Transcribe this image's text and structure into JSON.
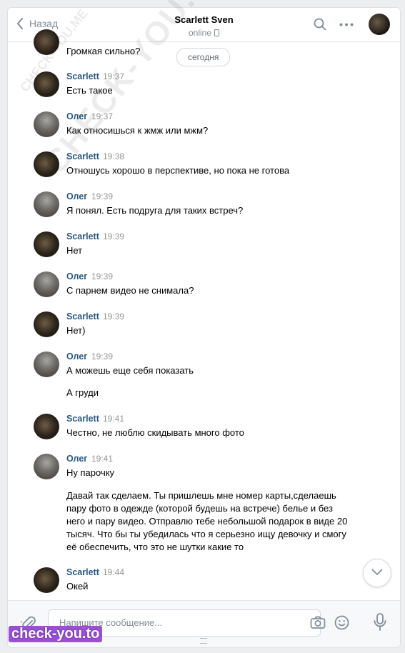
{
  "header": {
    "back_label": "Назад",
    "title": "Scarlett Sven",
    "status": "online"
  },
  "date_divider": "сегодня",
  "partial_message": "Громкая сильно?",
  "messages": [
    {
      "author": "Scarlett",
      "time": "19:37",
      "avatar": "scarlett",
      "lines": [
        "Есть такое"
      ]
    },
    {
      "author": "Олег",
      "time": "19:37",
      "avatar": "oleg",
      "lines": [
        "Как относишься к жмж или мжм?"
      ]
    },
    {
      "author": "Scarlett",
      "time": "19:38",
      "avatar": "scarlett",
      "lines": [
        "Отношусь хорошо в перспективе, но пока не готова"
      ]
    },
    {
      "author": "Олег",
      "time": "19:39",
      "avatar": "oleg",
      "lines": [
        "Я понял. Есть подруга для таких встреч?"
      ]
    },
    {
      "author": "Scarlett",
      "time": "19:39",
      "avatar": "scarlett",
      "lines": [
        "Нет"
      ]
    },
    {
      "author": "Олег",
      "time": "19:39",
      "avatar": "oleg",
      "lines": [
        "С парнем видео не снимала?"
      ]
    },
    {
      "author": "Scarlett",
      "time": "19:39",
      "avatar": "scarlett",
      "lines": [
        "Нет)"
      ]
    },
    {
      "author": "Олег",
      "time": "19:39",
      "avatar": "oleg",
      "lines": [
        "А можешь еще себя показать",
        "А груди"
      ]
    },
    {
      "author": "Scarlett",
      "time": "19:41",
      "avatar": "scarlett",
      "lines": [
        "Честно, не люблю скидывать много фото"
      ]
    },
    {
      "author": "Олег",
      "time": "19:41",
      "avatar": "oleg",
      "lines": [
        "Ну парочку",
        "Давай так сделаем. Ты пришлешь мне номер карты,сделаешь пару фото в одежде (которой будешь на встрече) белье и без него и пару видео. Отправлю тебе небольшой подарок в виде 20 тысяч. Что бы ты убедилась что я серьезно ищу девочку и смогу её обеспечить, что это не шутки какие то"
      ]
    },
    {
      "author": "Scarlett",
      "time": "19:44",
      "avatar": "scarlett",
      "lines": [
        "Окей"
      ]
    }
  ],
  "composer": {
    "placeholder": "Напишите сообщение..."
  },
  "watermarks": {
    "diagonal": "CHECK-YOU.ME",
    "small": "CHECK-YOU.ME",
    "badge": "check-you.to"
  },
  "colors": {
    "author_name": "#2a5885",
    "accent": "#5181b8",
    "badge": "#9b4fd6"
  },
  "icons": [
    "back-chevron-icon",
    "phone-icon",
    "search-icon",
    "more-icon",
    "chevron-down-icon",
    "paperclip-icon",
    "camera-icon",
    "emoji-icon",
    "microphone-icon"
  ]
}
